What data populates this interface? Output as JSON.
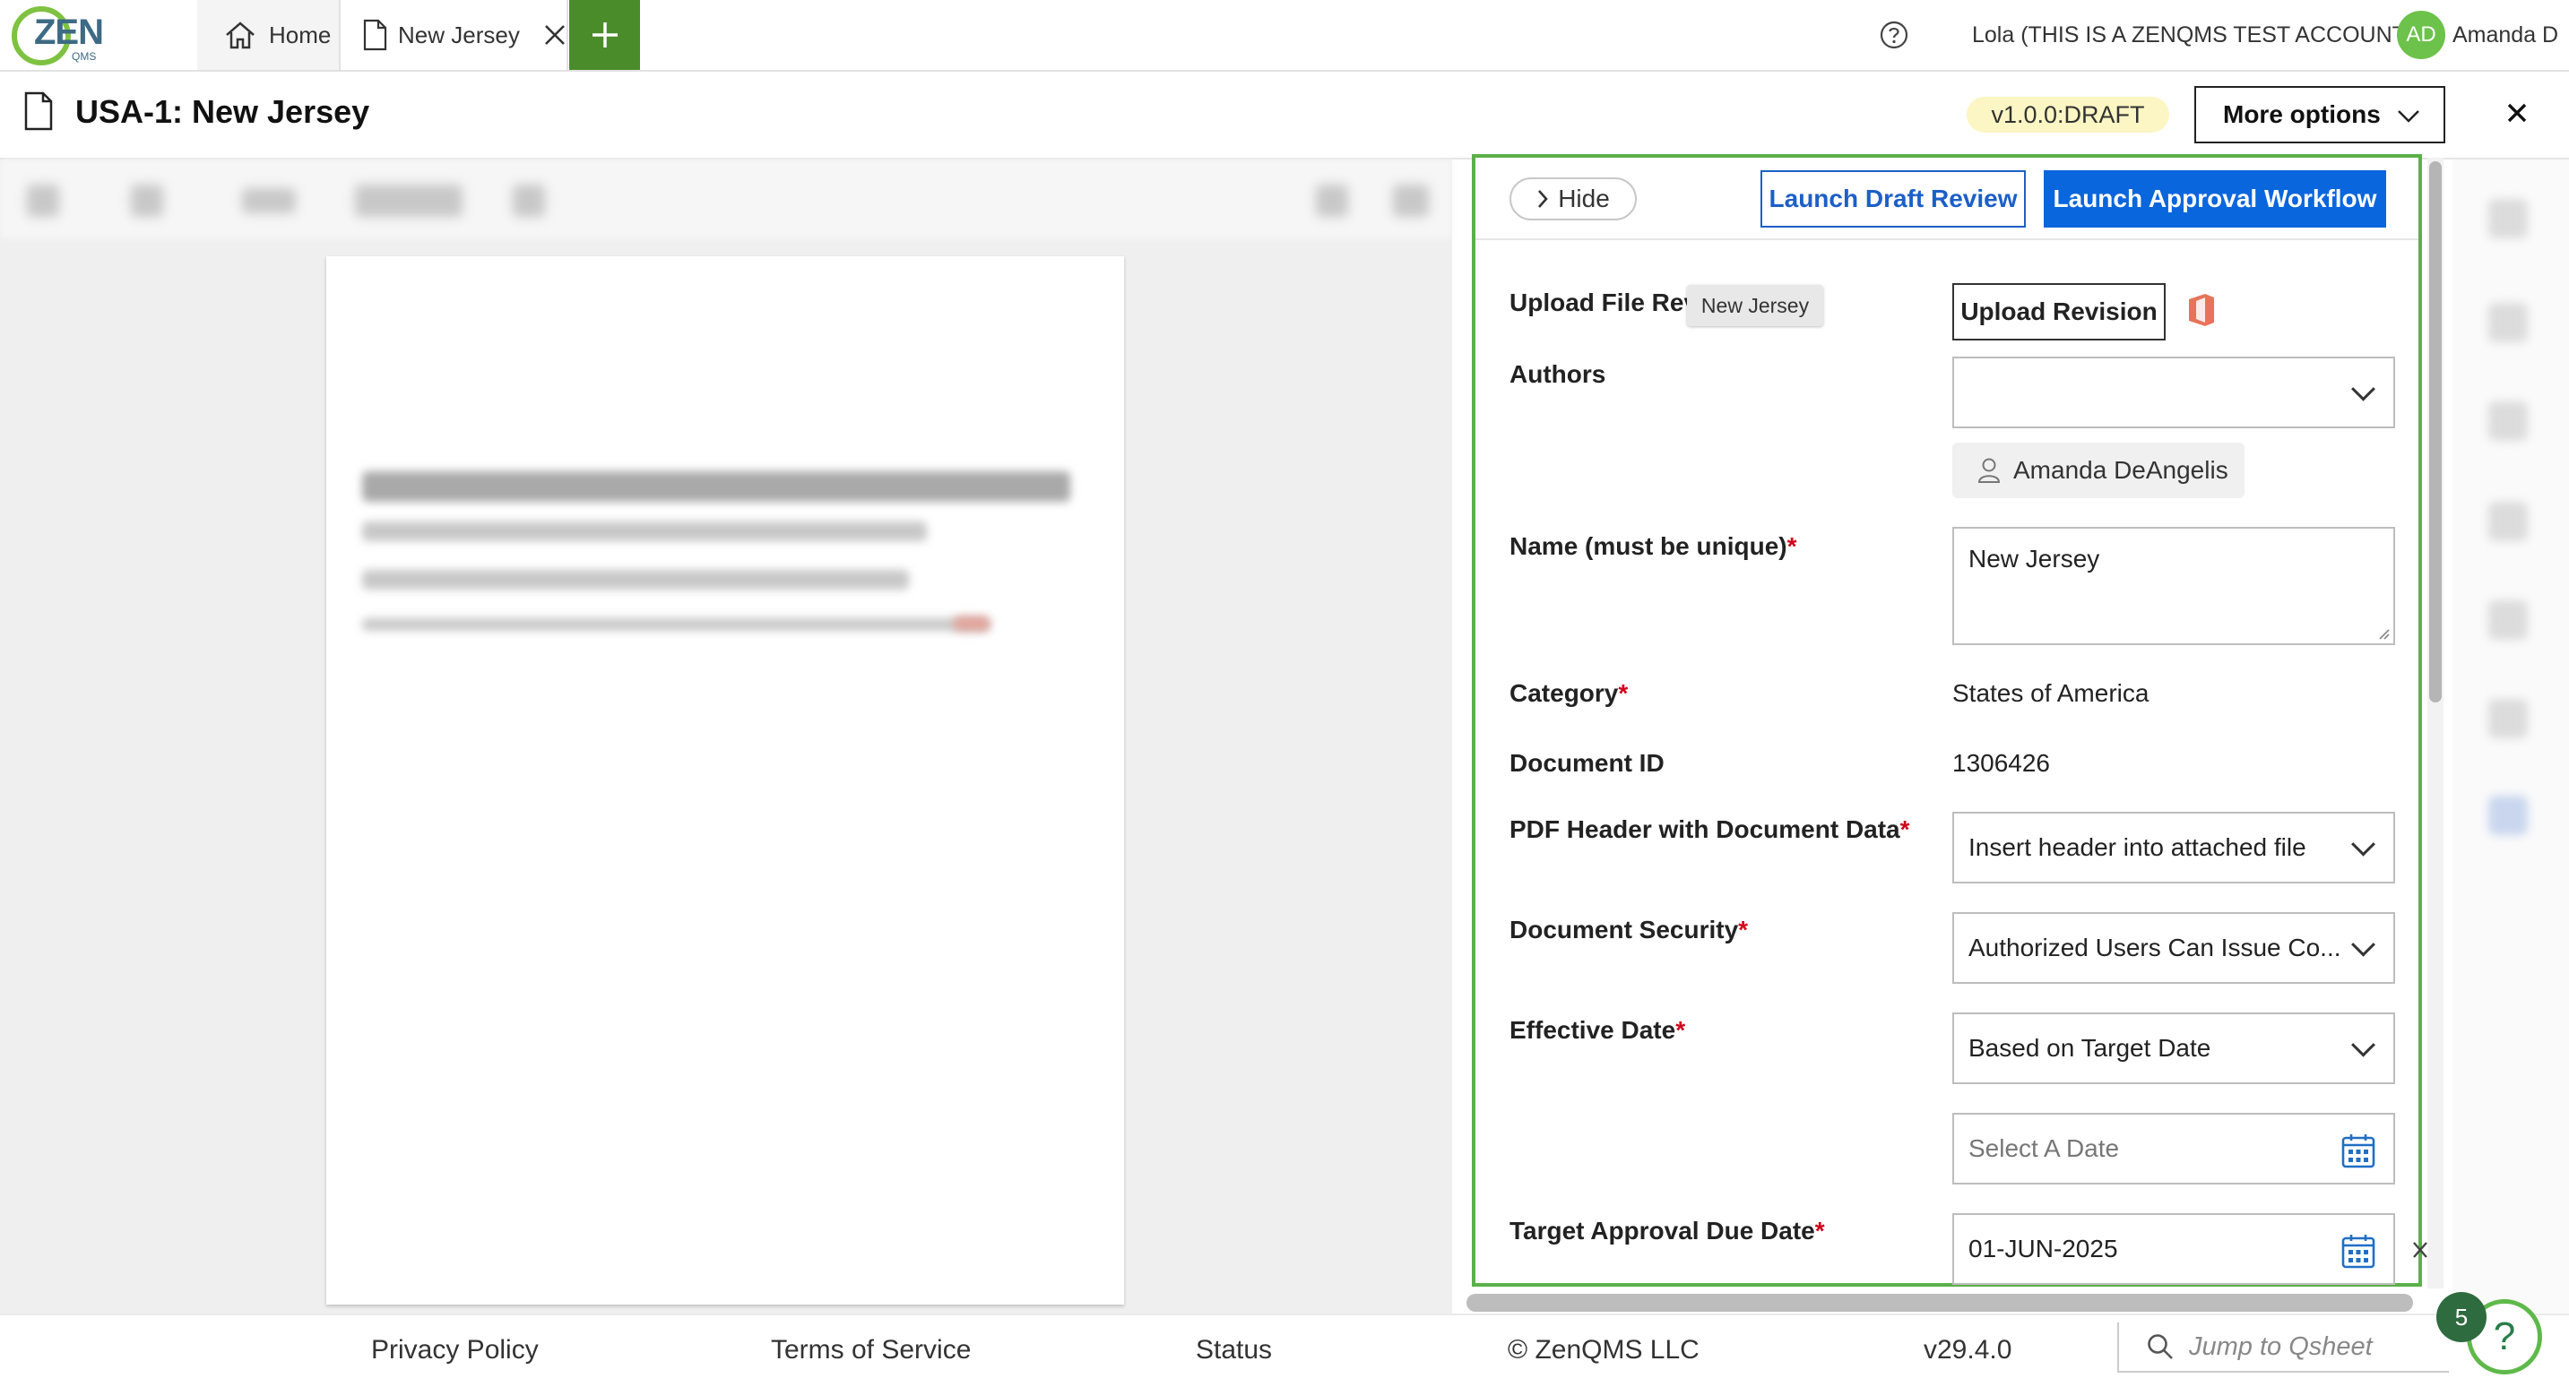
{
  "app": {
    "logo_text": "ZEN",
    "logo_sub": "QMS"
  },
  "tabs": [
    {
      "label": "Home",
      "icon": "home-icon"
    },
    {
      "label": "New Jersey",
      "icon": "document-icon"
    }
  ],
  "header": {
    "help_icon": "question-circle-icon",
    "account": "Lola (THIS IS A ZENQMS TEST ACCOUNT)",
    "avatar_initials": "AD",
    "user_name": "Amanda D"
  },
  "titlebar": {
    "title": "USA-1: New Jersey",
    "version": "v1.0.0:DRAFT",
    "more_options": "More options",
    "close_icon": "close-icon"
  },
  "panel": {
    "hide_label": "Hide",
    "draft_review_label": "Launch Draft Review",
    "approval_workflow_label": "Launch Approval Workflow",
    "tooltip": "New Jersey",
    "fields": {
      "upload_label": "Upload File Revi",
      "upload_button": "Upload Revision",
      "authors_label": "Authors",
      "authors_value": "",
      "author_chip": "Amanda DeAngelis",
      "name_label": "Name (must be unique)",
      "name_value": "New Jersey",
      "category_label": "Category",
      "category_value": "States of America",
      "docid_label": "Document ID",
      "docid_value": "1306426",
      "pdf_header_label": "PDF Header with Document Data",
      "pdf_header_value": "Insert header into attached file",
      "security_label": "Document Security",
      "security_value": "Authorized Users Can Issue Co...",
      "effective_label": "Effective Date",
      "effective_value": "Based on Target Date",
      "date_placeholder": "Select A Date",
      "target_label": "Target Approval Due Date",
      "target_value": "01-JUN-2025",
      "required_mark": "*"
    }
  },
  "footer": {
    "privacy": "Privacy Policy",
    "terms": "Terms of Service",
    "status": "Status",
    "copyright": "© ZenQMS LLC",
    "version": "v29.4.0",
    "search_placeholder": "Jump to Qsheet",
    "help_badge": "5",
    "help_glyph": "?"
  },
  "colors": {
    "brand_green": "#4a8c2a",
    "panel_border": "#5bb04a",
    "primary_blue": "#0a66dc",
    "required_red": "#d0021b",
    "draft_badge": "#fcf6c4"
  }
}
